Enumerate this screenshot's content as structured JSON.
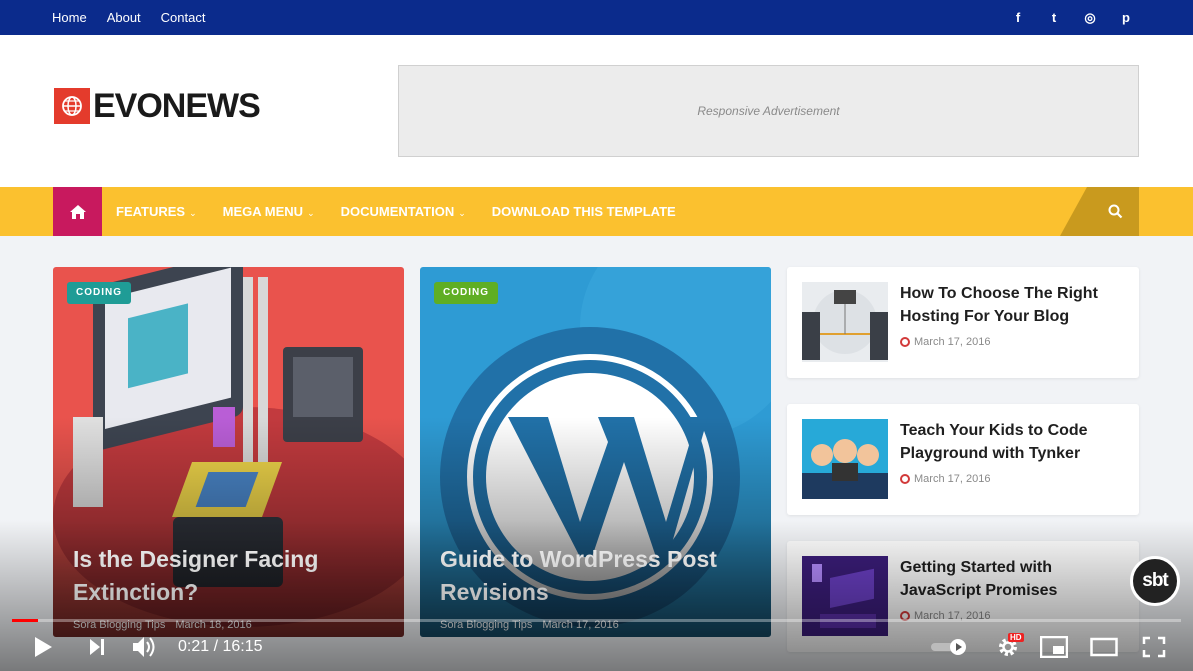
{
  "topbar": {
    "links": [
      "Home",
      "About",
      "Contact"
    ],
    "social": [
      "facebook-icon",
      "twitter-icon",
      "instagram-icon",
      "pinterest-icon"
    ],
    "social_glyphs": [
      "f",
      "t",
      "◎",
      "p"
    ]
  },
  "header": {
    "logo_text": "EVONEWS",
    "ad_text": "Responsive Advertisement"
  },
  "nav": {
    "items": [
      "FEATURES",
      "MEGA MENU",
      "DOCUMENTATION",
      "DOWNLOAD THIS TEMPLATE"
    ],
    "colors": {
      "bar": "#fbc12f",
      "home": "#c8195e",
      "search": "#c99a1e"
    }
  },
  "featured": [
    {
      "tag": "CODING",
      "title": "Is the Designer Facing Extinction?",
      "author": "Sora Blogging Tips",
      "date": "March 18, 2016"
    },
    {
      "tag": "CODING",
      "title": "Guide to WordPress Post Revisions",
      "author": "Sora Blogging Tips",
      "date": "March 17, 2016"
    }
  ],
  "side_posts": [
    {
      "title": "How To Choose The Right Hosting For Your Blog",
      "date": "March 17, 2016"
    },
    {
      "title": "Teach Your Kids to Code Playground with Tynker",
      "date": "March 17, 2016"
    },
    {
      "title": "Getting Started with JavaScript Promises",
      "date": "March 17, 2016"
    }
  ],
  "player": {
    "time": "0:21 / 16:15",
    "progress_fraction": 0.022,
    "quality_badge": "HD",
    "channel_badge": "sbt"
  }
}
